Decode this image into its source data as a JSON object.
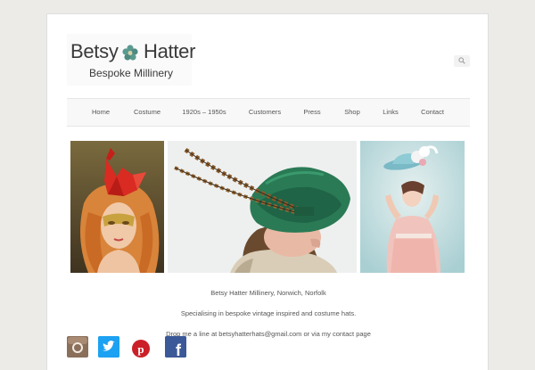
{
  "logo": {
    "word1": "Betsy",
    "word2": "Hatter",
    "subtitle": "Bespoke Millinery",
    "flower_color": "#4e8a80"
  },
  "search": {
    "icon": "search-icon"
  },
  "nav": {
    "items": [
      "Home",
      "Costume",
      "1920s – 1950s",
      "Customers",
      "Press",
      "Shop",
      "Links",
      "Contact"
    ]
  },
  "gallery": {
    "photos": [
      "red-origami-bird-hat-photo",
      "green-pheasant-feather-hat-photo",
      "blue-flower-hat-photo"
    ]
  },
  "content": {
    "line1": "Betsy Hatter Millinery, Norwich, Norfolk",
    "line2": "Specialising in bespoke vintage inspired and costume hats.",
    "line3": "Drop me a line at betsyhatterhats@gmail.com or via my contact page"
  },
  "social": {
    "icons": [
      "instagram-icon",
      "twitter-icon",
      "pinterest-icon",
      "facebook-icon"
    ],
    "colors": {
      "twitter": "#1da1f2",
      "pinterest": "#cb2027",
      "facebook": "#3b5998"
    }
  }
}
